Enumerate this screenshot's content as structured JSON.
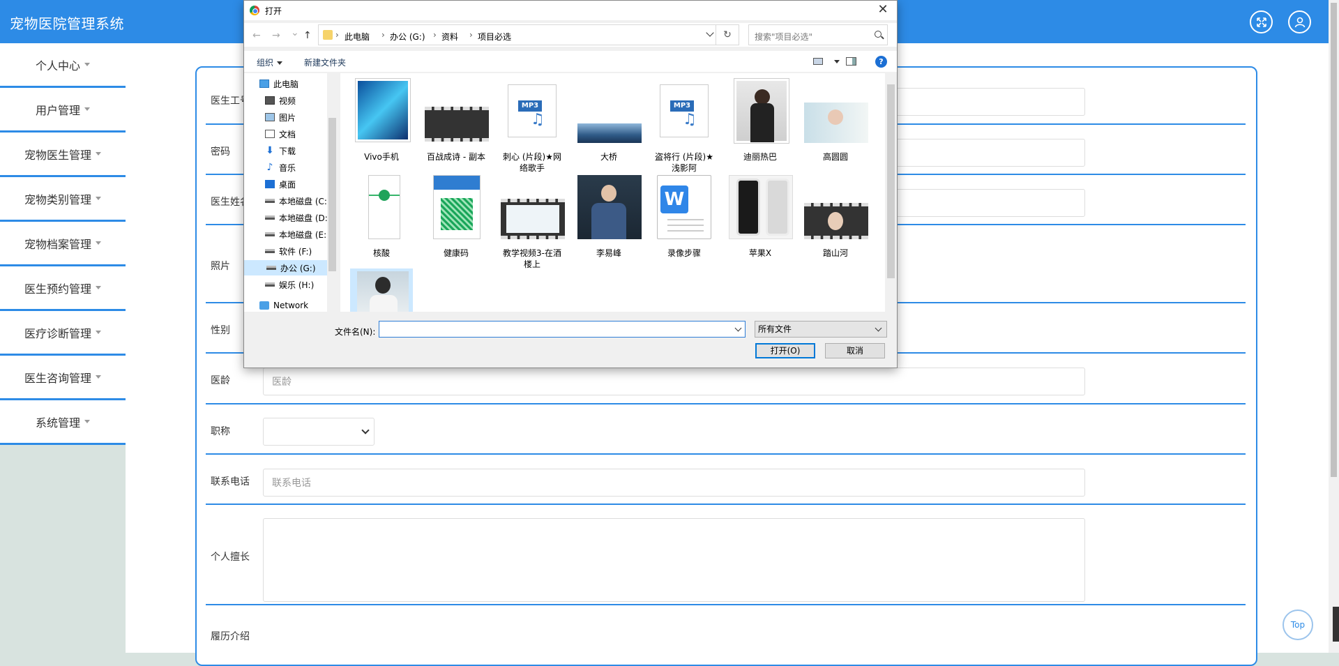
{
  "app": {
    "title": "宠物医院管理系统"
  },
  "header_icons": [
    {
      "name": "fullscreen-icon"
    },
    {
      "name": "user-icon"
    }
  ],
  "sidebar": {
    "items": [
      {
        "label": "个人中心"
      },
      {
        "label": "用户管理"
      },
      {
        "label": "宠物医生管理"
      },
      {
        "label": "宠物类别管理"
      },
      {
        "label": "宠物档案管理"
      },
      {
        "label": "医生预约管理"
      },
      {
        "label": "医疗诊断管理"
      },
      {
        "label": "医生咨询管理"
      },
      {
        "label": "系统管理"
      }
    ]
  },
  "form": {
    "fields": {
      "doctor_id": {
        "label": "医生工号"
      },
      "password": {
        "label": "密码"
      },
      "doctor_name": {
        "label": "医生姓名"
      },
      "photo": {
        "label": "照片"
      },
      "gender": {
        "label": "性别"
      },
      "years": {
        "label": "医龄",
        "placeholder": "医龄"
      },
      "title": {
        "label": "职称",
        "value": ""
      },
      "phone": {
        "label": "联系电话",
        "placeholder": "联系电话"
      },
      "specialty": {
        "label": "个人擅长"
      },
      "resume": {
        "label": "履历介绍"
      }
    }
  },
  "top_button": {
    "label": "Top"
  },
  "dialog": {
    "title": "打开",
    "close": "✕",
    "nav": {
      "back": "←",
      "forward": "→",
      "recent": "⌄",
      "up": "↑",
      "refresh": "↻"
    },
    "breadcrumbs": [
      "此电脑",
      "办公 (G:)",
      "资料",
      "项目必选"
    ],
    "search_placeholder": "搜索\"项目必选\"",
    "toolbar": {
      "organize": "组织",
      "new_folder": "新建文件夹",
      "help": "?"
    },
    "nav_pane": [
      {
        "label": "此电脑",
        "icon": "computer-icon"
      },
      {
        "label": "视频",
        "icon": "video-folder-icon"
      },
      {
        "label": "图片",
        "icon": "picture-folder-icon"
      },
      {
        "label": "文档",
        "icon": "document-folder-icon"
      },
      {
        "label": "下载",
        "icon": "download-icon"
      },
      {
        "label": "音乐",
        "icon": "music-icon"
      },
      {
        "label": "桌面",
        "icon": "desktop-icon"
      },
      {
        "label": "本地磁盘 (C:",
        "icon": "drive-icon"
      },
      {
        "label": "本地磁盘 (D:",
        "icon": "drive-icon"
      },
      {
        "label": "本地磁盘 (E:",
        "icon": "drive-icon"
      },
      {
        "label": "软件 (F:)",
        "icon": "drive-icon"
      },
      {
        "label": "办公 (G:)",
        "icon": "drive-icon",
        "selected": true
      },
      {
        "label": "娱乐 (H:)",
        "icon": "drive-icon"
      },
      {
        "label": "Network",
        "icon": "network-icon"
      }
    ],
    "files": [
      {
        "name": "Vivo手机",
        "kind": "phone-image"
      },
      {
        "name": "百战成诗 - 副本",
        "kind": "video"
      },
      {
        "name": "刺心 (片段)★网络歌手",
        "kind": "mp3"
      },
      {
        "name": "大桥",
        "kind": "landscape-image"
      },
      {
        "name": "盗将行 (片段)★浅影阿",
        "kind": "mp3"
      },
      {
        "name": "迪丽热巴",
        "kind": "portrait-image"
      },
      {
        "name": "高圆圆",
        "kind": "portrait-image"
      },
      {
        "name": "核酸",
        "kind": "screenshot-image"
      },
      {
        "name": "健康码",
        "kind": "screenshot-image"
      },
      {
        "name": "教学视频3-在酒楼上",
        "kind": "video"
      },
      {
        "name": "李易峰",
        "kind": "portrait-image"
      },
      {
        "name": "录像步骤",
        "kind": "wps-document"
      },
      {
        "name": "苹果X",
        "kind": "phone-image"
      },
      {
        "name": "踏山河",
        "kind": "video"
      },
      {
        "name": "",
        "kind": "portrait-image"
      }
    ],
    "filename_label": "文件名(N):",
    "filename_value": "",
    "filetype": "所有文件",
    "open_button": "打开(O)",
    "cancel_button": "取消"
  },
  "colors": {
    "brand": "#2d8be6",
    "sidebar_bg": "#d8e3df",
    "dialog_bg": "#f0f0f0",
    "selection": "#cce8ff"
  }
}
